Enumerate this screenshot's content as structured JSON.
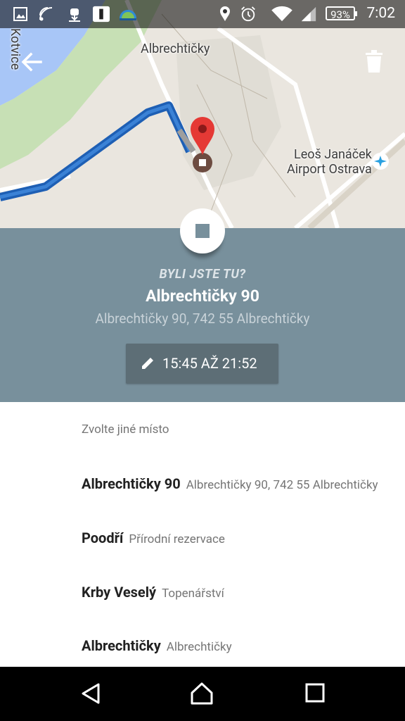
{
  "status_bar": {
    "battery": "93%",
    "time": "7:02",
    "left_icons": [
      "image-icon",
      "cast-icon",
      "android-download-icon",
      "app-icon",
      "app-icon-2"
    ],
    "right_icons": [
      "location-icon",
      "alarm-icon",
      "wifi-icon",
      "signal-icon",
      "battery-icon"
    ]
  },
  "map": {
    "labels": {
      "top_village": "Albrechtičky",
      "left_edge": "Kotvice",
      "airport_line1": "Leoš Janáček",
      "airport_line2": "Airport Ostrava"
    },
    "colors": {
      "route": "#1e5fb4",
      "pin": "#e53935",
      "water": "#a8c6f7",
      "park": "#c7e0b5"
    }
  },
  "info_card": {
    "question": "BYLI JSTE TU?",
    "title": "Albrechtičky 90",
    "address": "Albrechtičky 90, 742 55 Albrechtičky",
    "time_range": "15:45 AŽ 21:52",
    "bg_color": "#78909c"
  },
  "alternatives": {
    "heading": "Zvolte jiné místo",
    "items": [
      {
        "name": "Albrechtičky 90",
        "detail": "Albrechtičky 90, 742 55 Albrechtičky"
      },
      {
        "name": "Poodří",
        "detail": "Přírodní rezervace"
      },
      {
        "name": "Krby Veselý",
        "detail": "Topenářství"
      },
      {
        "name": "Albrechtičky",
        "detail": "Albrechtičky"
      }
    ]
  },
  "nav_bar": {
    "buttons": [
      "back-icon",
      "home-icon",
      "recents-icon"
    ]
  }
}
